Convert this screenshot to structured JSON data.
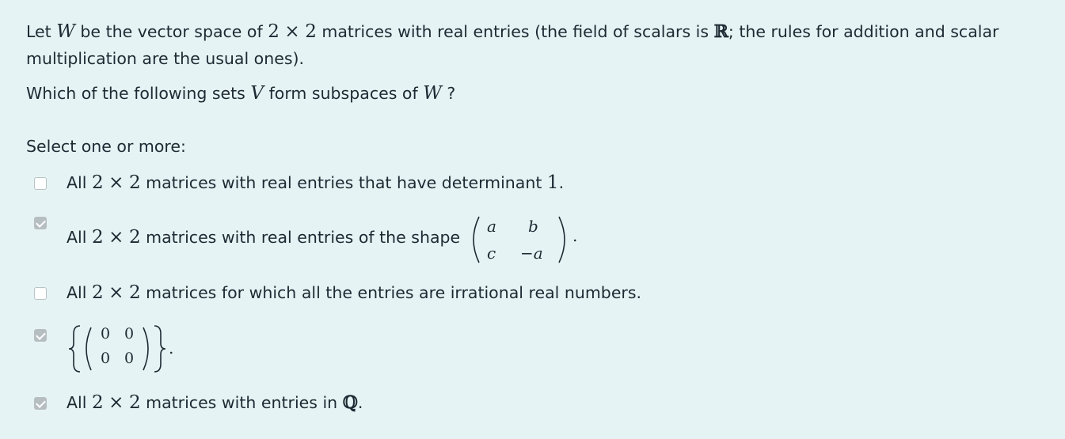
{
  "question": {
    "line1_prefix": "Let",
    "W": "W",
    "line1_mid": "be the vector space of",
    "two_a": "2",
    "times_a": "×",
    "two_b": "2",
    "line1_mid2": "matrices with real entries (the field of scalars is",
    "R": "ℝ",
    "line1_suffix": "; the rules for addition and scalar",
    "line2": "multiplication are the usual ones).",
    "q_prefix": "Which of the following sets",
    "V": "V",
    "q_mid": "form subspaces of",
    "W2": "W",
    "q_suffix": "?"
  },
  "prompt": "Select one or more:",
  "options": [
    {
      "checked": false,
      "two_a": "2",
      "times": "×",
      "two_b": "2",
      "text": "matrices with real entries that have determinant",
      "prefix": "All",
      "det": "1",
      "end": "."
    },
    {
      "checked": true,
      "prefix": "All",
      "two_a": "2",
      "times": "×",
      "two_b": "2",
      "text": "matrices with real entries of the shape",
      "m11": "a",
      "m12": "b",
      "m21": "c",
      "m22": "−a",
      "end": "."
    },
    {
      "checked": false,
      "prefix": "All",
      "two_a": "2",
      "times": "×",
      "two_b": "2",
      "text": "matrices for which all the entries are irrational real numbers."
    },
    {
      "checked": true,
      "m11": "0",
      "m12": "0",
      "m21": "0",
      "m22": "0",
      "end": "."
    },
    {
      "checked": true,
      "prefix": "All",
      "two_a": "2",
      "times": "×",
      "two_b": "2",
      "text": "matrices with entries in",
      "Q": "ℚ",
      "end": "."
    }
  ],
  "colors": {
    "panel_bg": "#e6f3f4",
    "text": "#1e2a33",
    "checkbox_checked": "#b7bec2",
    "checkbox_border": "#b9c3c6"
  }
}
